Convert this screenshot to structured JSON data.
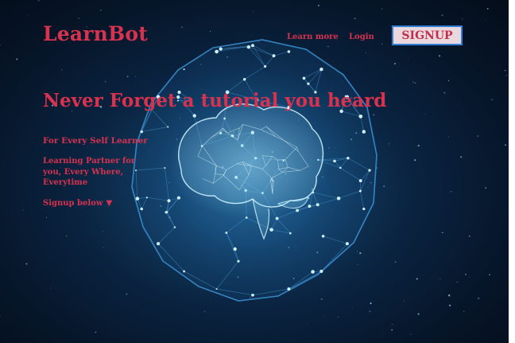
{
  "brand": {
    "name": "LearnBot",
    "color": "#d8324f"
  },
  "nav": {
    "learn_more": "Learn more",
    "login": "Login",
    "signup": "SIGNUP"
  },
  "hero": {
    "title": "Never Forget a tutorial you heard",
    "tagline": "For Every Self Learner",
    "description": "Learning Partner for you, Every Where, Everytime",
    "cta": "Signup below",
    "cta_icon": "▼"
  },
  "background": {
    "image": "neural network brain over glowing polygon sphere",
    "icons": [
      "brain-wireframe-icon",
      "polygon-network-sphere"
    ]
  },
  "colors": {
    "accent": "#d8324f",
    "background_dark": "#061528",
    "glow": "#6fd4ff",
    "button_border": "#2f7fd6",
    "button_bg": "#e9d9de"
  }
}
